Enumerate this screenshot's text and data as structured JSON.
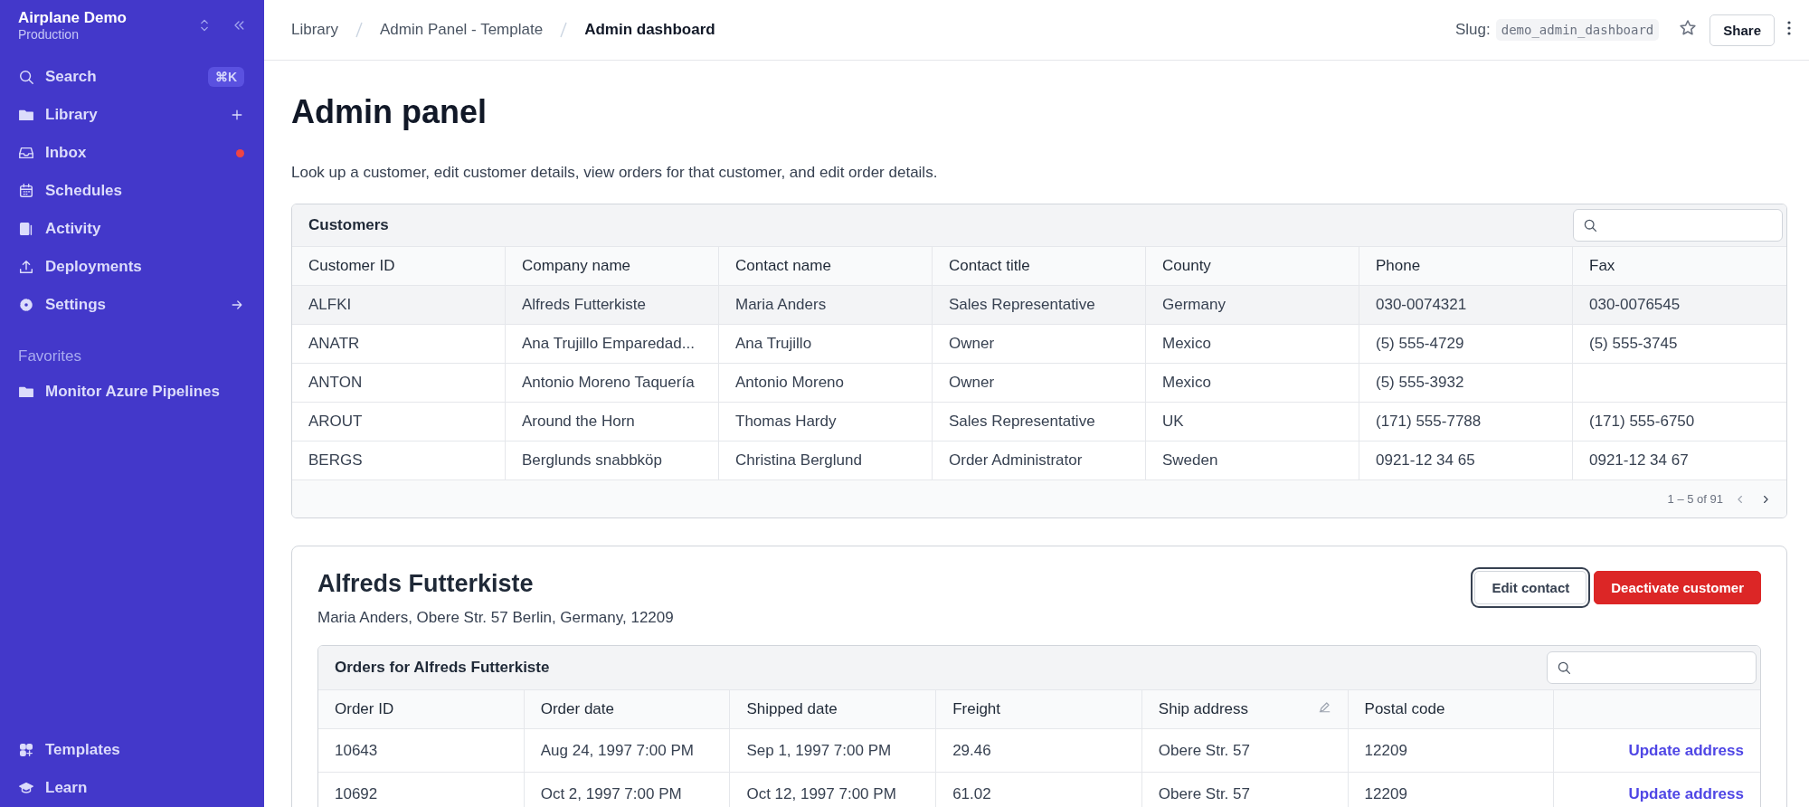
{
  "sidebar": {
    "workspace": "Airplane Demo",
    "environment": "Production",
    "items": [
      {
        "label": "Search",
        "shortcut": "⌘K",
        "unread": false
      },
      {
        "label": "Library",
        "unread": false
      },
      {
        "label": "Inbox",
        "unread": true
      },
      {
        "label": "Schedules",
        "unread": false
      },
      {
        "label": "Activity",
        "unread": false
      },
      {
        "label": "Deployments",
        "unread": false
      },
      {
        "label": "Settings",
        "unread": false
      }
    ],
    "favorites_heading": "Favorites",
    "favorites": [
      {
        "label": "Monitor Azure Pipelines"
      }
    ],
    "bottom_items": [
      {
        "label": "Templates"
      },
      {
        "label": "Learn"
      }
    ]
  },
  "header": {
    "breadcrumbs": [
      "Library",
      "Admin Panel - Template",
      "Admin dashboard"
    ],
    "slug_label": "Slug:",
    "slug": "demo_admin_dashboard",
    "share": "Share"
  },
  "page": {
    "title": "Admin panel",
    "description": "Look up a customer, edit customer details, view orders for that customer, and edit order details."
  },
  "customers": {
    "title": "Customers",
    "columns": [
      "Customer ID",
      "Company name",
      "Contact name",
      "Contact title",
      "County",
      "Phone",
      "Fax"
    ],
    "rows": [
      {
        "selected": true,
        "cells": [
          "ALFKI",
          "Alfreds Futterkiste",
          "Maria Anders",
          "Sales Representative",
          "Germany",
          "030-0074321",
          "030-0076545"
        ]
      },
      {
        "selected": false,
        "cells": [
          "ANATR",
          "Ana Trujillo Emparedad...",
          "Ana Trujillo",
          "Owner",
          "Mexico",
          "(5) 555-4729",
          "(5) 555-3745"
        ]
      },
      {
        "selected": false,
        "cells": [
          "ANTON",
          "Antonio Moreno Taquería",
          "Antonio Moreno",
          "Owner",
          "Mexico",
          "(5) 555-3932",
          ""
        ]
      },
      {
        "selected": false,
        "cells": [
          "AROUT",
          "Around the Horn",
          "Thomas Hardy",
          "Sales Representative",
          "UK",
          "(171) 555-7788",
          "(171) 555-6750"
        ]
      },
      {
        "selected": false,
        "cells": [
          "BERGS",
          "Berglunds snabbköp",
          "Christina Berglund",
          "Order Administrator",
          "Sweden",
          "0921-12 34 65",
          "0921-12 34 67"
        ]
      }
    ],
    "pagination": "1 – 5 of 91"
  },
  "customer_detail": {
    "name": "Alfreds Futterkiste",
    "address": "Maria Anders, Obere Str. 57 Berlin, Germany, 12209",
    "buttons": [
      {
        "label": "Edit contact",
        "kind": "secondary",
        "focused": true
      },
      {
        "label": "Deactivate customer",
        "kind": "danger",
        "focused": false
      }
    ],
    "orders": {
      "title": "Orders for Alfreds Futterkiste",
      "columns": [
        {
          "label": "Order ID",
          "editable": false
        },
        {
          "label": "Order date",
          "editable": false
        },
        {
          "label": "Shipped date",
          "editable": false
        },
        {
          "label": "Freight",
          "editable": false
        },
        {
          "label": "Ship address",
          "editable": true
        },
        {
          "label": "Postal code",
          "editable": false
        },
        {
          "editable": false
        }
      ],
      "rows": [
        {
          "cells": [
            "10643",
            "Aug 24, 1997 7:00 PM",
            "Sep 1, 1997 7:00 PM",
            "29.46",
            "Obere Str. 57",
            "12209"
          ],
          "action": "Update address"
        },
        {
          "cells": [
            "10692",
            "Oct 2, 1997 7:00 PM",
            "Oct 12, 1997 7:00 PM",
            "61.02",
            "Obere Str. 57",
            "12209"
          ],
          "action": "Update address"
        }
      ]
    }
  }
}
